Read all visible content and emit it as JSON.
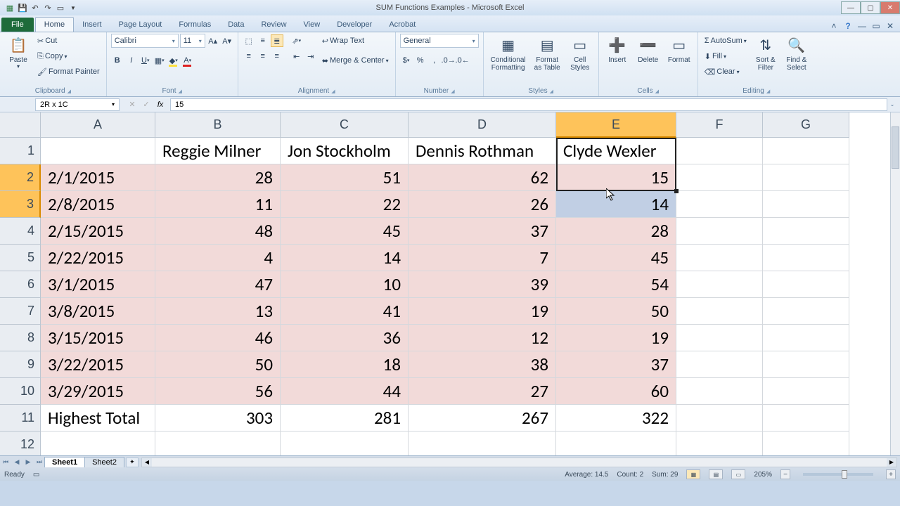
{
  "window": {
    "title": "SUM Functions Examples - Microsoft Excel"
  },
  "tabs": {
    "file": "File",
    "items": [
      "Home",
      "Insert",
      "Page Layout",
      "Formulas",
      "Data",
      "Review",
      "View",
      "Developer",
      "Acrobat"
    ],
    "active": "Home"
  },
  "ribbon": {
    "clipboard": {
      "label": "Clipboard",
      "paste": "Paste",
      "cut": "Cut",
      "copy": "Copy",
      "fp": "Format Painter"
    },
    "font": {
      "label": "Font",
      "name": "Calibri",
      "size": "11"
    },
    "alignment": {
      "label": "Alignment",
      "wrap": "Wrap Text",
      "merge": "Merge & Center"
    },
    "number": {
      "label": "Number",
      "format": "General"
    },
    "styles": {
      "label": "Styles",
      "cf": "Conditional\nFormatting",
      "fat": "Format\nas Table",
      "cs": "Cell\nStyles"
    },
    "cells": {
      "label": "Cells",
      "insert": "Insert",
      "delete": "Delete",
      "format": "Format"
    },
    "editing": {
      "label": "Editing",
      "autosum": "AutoSum",
      "fill": "Fill",
      "clear": "Clear",
      "sort": "Sort &\nFilter",
      "find": "Find &\nSelect"
    }
  },
  "formulabar": {
    "namebox": "2R x 1C",
    "fx": "15"
  },
  "columns": [
    "A",
    "B",
    "C",
    "D",
    "E",
    "F",
    "G"
  ],
  "rows": [
    "1",
    "2",
    "3",
    "4",
    "5",
    "6",
    "7",
    "8",
    "9",
    "10",
    "11",
    "12"
  ],
  "headers": [
    "",
    "Reggie Milner",
    "Jon Stockholm",
    "Dennis Rothman",
    "Clyde Wexler"
  ],
  "data": [
    [
      "2/1/2015",
      "28",
      "51",
      "62",
      "15"
    ],
    [
      "2/8/2015",
      "11",
      "22",
      "26",
      "14"
    ],
    [
      "2/15/2015",
      "48",
      "45",
      "37",
      "28"
    ],
    [
      "2/22/2015",
      "4",
      "14",
      "7",
      "45"
    ],
    [
      "3/1/2015",
      "47",
      "10",
      "39",
      "54"
    ],
    [
      "3/8/2015",
      "13",
      "41",
      "19",
      "50"
    ],
    [
      "3/15/2015",
      "46",
      "36",
      "12",
      "19"
    ],
    [
      "3/22/2015",
      "50",
      "18",
      "38",
      "37"
    ],
    [
      "3/29/2015",
      "56",
      "44",
      "27",
      "60"
    ]
  ],
  "totals": [
    "Highest  Total",
    "303",
    "281",
    "267",
    "322"
  ],
  "sheets": {
    "active": "Sheet1",
    "other": "Sheet2"
  },
  "status": {
    "ready": "Ready",
    "avg": "Average: 14.5",
    "count": "Count: 2",
    "sum": "Sum: 29",
    "zoom": "205%"
  }
}
